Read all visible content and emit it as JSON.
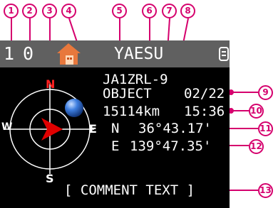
{
  "callouts": [
    "1",
    "2",
    "3",
    "4",
    "5",
    "6",
    "7",
    "8",
    "9",
    "10",
    "11",
    "12",
    "13"
  ],
  "status_bar": {
    "number_1": "1",
    "number_2": "0",
    "home_icon": "house-icon",
    "brand": "YAESU",
    "scroll_icon": "mini-logo-icon"
  },
  "station": {
    "callsign": "JA1ZRL-9",
    "type": "OBJECT",
    "date": "02/22",
    "distance": "15114km",
    "time": "15:36",
    "lat_hemi": "N",
    "lat": "36°43.17'",
    "lon_hemi": "E",
    "lon": "139°47.35'",
    "comment": "[ COMMENT TEXT ]"
  },
  "compass": {
    "north": "N",
    "south": "S",
    "east": "E",
    "west": "W",
    "colors": {
      "north_label": "#ff2020",
      "arrow": "#e00000",
      "dot": "#2a6bd8",
      "ring": "#ffffff"
    }
  },
  "colors": {
    "accent": "#d5006d",
    "screen_bg": "#000000",
    "status_bg": "#606060"
  }
}
